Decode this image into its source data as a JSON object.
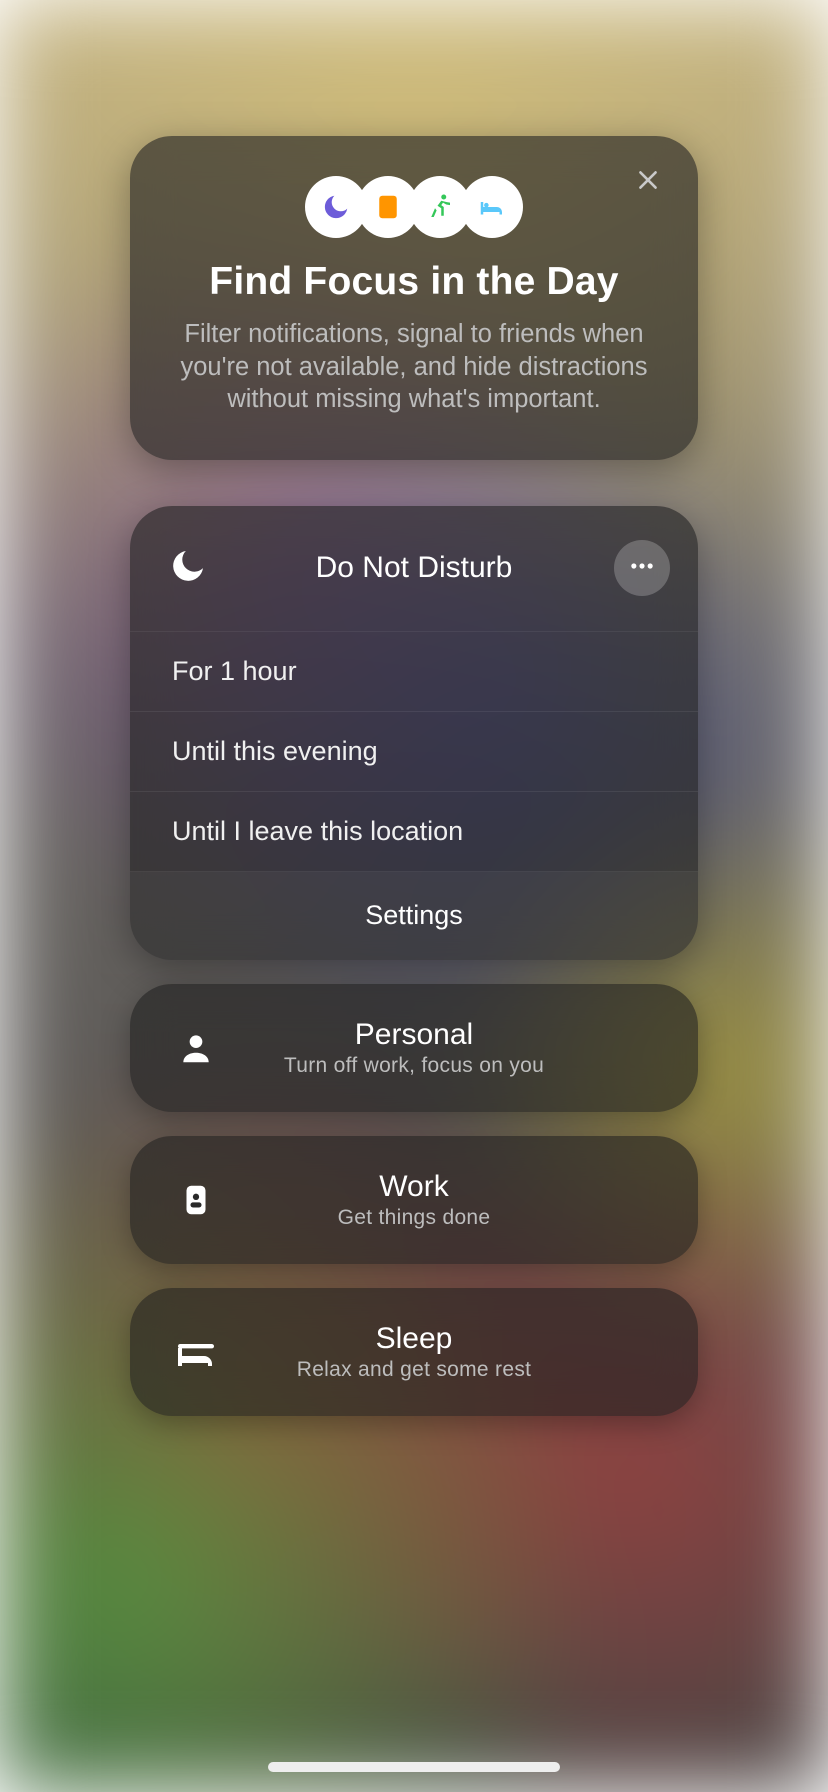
{
  "promo": {
    "title": "Find Focus in the Day",
    "subtitle": "Filter notifications, signal to friends when you're not available, and hide distractions without missing what's important."
  },
  "dnd": {
    "title": "Do Not Disturb",
    "options": {
      "0": "For 1 hour",
      "1": "Until this evening",
      "2": "Until I leave this location"
    },
    "settings": "Settings"
  },
  "modes": {
    "personal": {
      "title": "Personal",
      "sub": "Turn off work, focus on you"
    },
    "work": {
      "title": "Work",
      "sub": "Get things done"
    },
    "sleep": {
      "title": "Sleep",
      "sub": "Relax and get some rest"
    }
  },
  "colors": {
    "moon": "#6d5cd9",
    "book": "#ff9500",
    "runner": "#34c759",
    "bed": "#5ac8fa"
  }
}
